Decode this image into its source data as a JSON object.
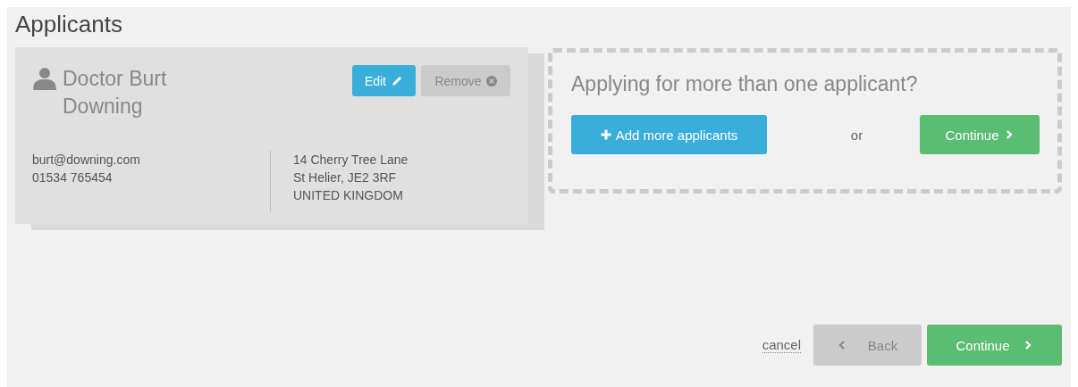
{
  "title": "Applicants",
  "applicant": {
    "name": "Doctor Burt Downing",
    "edit": "Edit",
    "remove": "Remove",
    "contact": [
      "burt@downing.com",
      "01534 765454"
    ],
    "address": [
      "14 Cherry Tree Lane",
      "St Helier, JE2 3RF",
      "UNITED KINGDOM"
    ]
  },
  "prompt": {
    "question": "Applying for more than one applicant?",
    "add": "Add more applicants",
    "or": "or",
    "continue": "Continue"
  },
  "footer": {
    "cancel": "cancel",
    "back": {
      "label": "Back",
      "disabled": true
    },
    "continue": "Continue"
  }
}
